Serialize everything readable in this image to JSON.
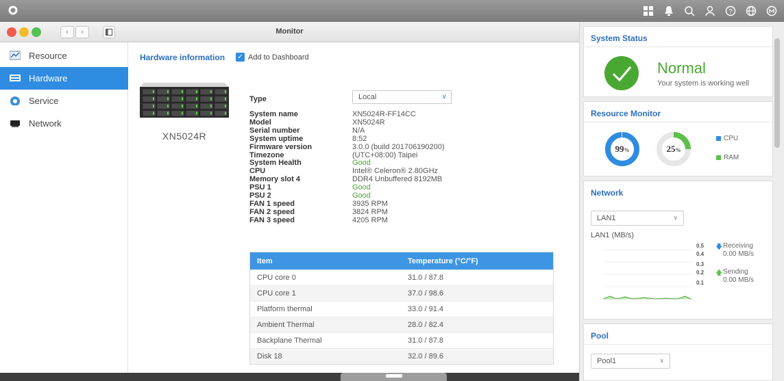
{
  "topbar": {
    "icons": [
      "grid-icon",
      "bell-icon",
      "search-icon",
      "user-icon",
      "help-icon",
      "globe-icon",
      "qts-icon"
    ]
  },
  "window": {
    "title": "Monitor"
  },
  "sidebar": {
    "items": [
      {
        "label": "Resource",
        "icon": "resource-icon"
      },
      {
        "label": "Hardware",
        "icon": "hardware-icon"
      },
      {
        "label": "Service",
        "icon": "service-icon"
      },
      {
        "label": "Network",
        "icon": "network-icon"
      }
    ]
  },
  "hardware": {
    "title": "Hardware information",
    "add_dashboard": "Add to Dashboard",
    "device_name": "XN5024R",
    "type_label": "Type",
    "type_value": "Local",
    "fields": [
      {
        "label": "System name",
        "value": "XN5024R-FF14CC"
      },
      {
        "label": "Model",
        "value": "XN5024R"
      },
      {
        "label": "Serial number",
        "value": "N/A"
      },
      {
        "label": "System uptime",
        "value": "8:52"
      },
      {
        "label": "Firmware version",
        "value": "3.0.0 (build 201706190200)"
      },
      {
        "label": "Timezone",
        "value": "(UTC+08:00) Taipei"
      },
      {
        "label": "System Health",
        "value": "Good"
      },
      {
        "label": "CPU",
        "value": "Intel® Celeron® 2.80GHz"
      },
      {
        "label": "Memory slot 4",
        "value": "DDR4 Unbuffered 8192MB"
      },
      {
        "label": "PSU 1",
        "value": "Good"
      },
      {
        "label": "PSU 2",
        "value": "Good"
      },
      {
        "label": "FAN 1 speed",
        "value": "3935 RPM"
      },
      {
        "label": "FAN 2 speed",
        "value": "3824 RPM"
      },
      {
        "label": "FAN 3 speed",
        "value": "4205 RPM"
      }
    ],
    "temp_table": {
      "headers": [
        "Item",
        "Temperature (°C/°F)"
      ],
      "rows": [
        [
          "CPU core 0",
          "31.0 / 87.8"
        ],
        [
          "CPU core 1",
          "37.0 / 98.6"
        ],
        [
          "Platform thermal",
          "33.0 / 91.4"
        ],
        [
          "Ambient Thermal",
          "28.0 / 82.4"
        ],
        [
          "Backplane Thermal",
          "31.0 / 87.8"
        ],
        [
          "Disk 18",
          "32.0 / 89.6"
        ]
      ]
    }
  },
  "panel": {
    "status": {
      "title": "System Status",
      "state": "Normal",
      "message": "Your system is working well",
      "color": "#49a832"
    },
    "resource": {
      "title": "Resource Monitor",
      "cpu": "99",
      "ram": "25",
      "unit": "%",
      "cpu_label": "CPU",
      "ram_label": "RAM",
      "cpu_color": "#2f8ce0",
      "ram_color": "#5cc04a",
      "cpu_fraction": 0.99,
      "ram_fraction": 0.25
    },
    "network": {
      "title": "Network",
      "interface": "LAN1",
      "chart_label": "LAN1 (MB/s)",
      "scale": [
        "0.5",
        "0.4",
        "0.3",
        "0.2",
        "0.1"
      ],
      "receiving_label": "Receiving",
      "receiving_value": "0.00 MB/s",
      "sending_label": "Sending",
      "sending_value": "0.00 MB/s"
    },
    "pool": {
      "title": "Pool",
      "selected": "Pool1"
    }
  }
}
